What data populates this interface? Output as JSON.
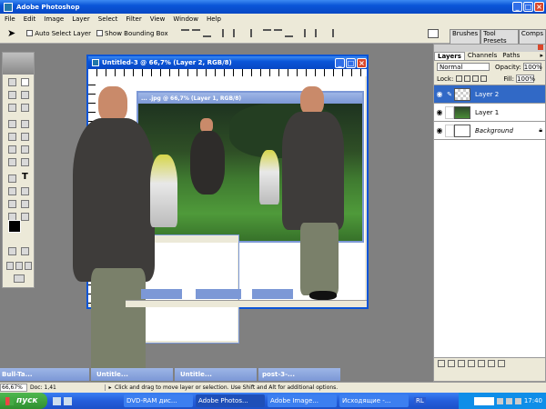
{
  "app": {
    "title": "Adobe Photoshop"
  },
  "menu": [
    "File",
    "Edit",
    "Image",
    "Layer",
    "Select",
    "Filter",
    "View",
    "Window",
    "Help"
  ],
  "options_bar": {
    "auto_select": "Auto Select Layer",
    "show_bbox": "Show Bounding Box",
    "palette_tabs": [
      "Brushes",
      "Tool Presets",
      "Comps"
    ]
  },
  "doc_main": {
    "title": "Untitled-3 @ 66,7% (Layer 2, RGB/8)"
  },
  "doc_photo": {
    "title": "... .jpg @ 66,7% (Layer 1, RGB/8)"
  },
  "minimized": [
    "Bull-Ta...",
    "Untitle...",
    "Untitle...",
    "post-3-..."
  ],
  "status": {
    "zoom": "66,67%",
    "doc": "Doc: 1,41",
    "hint": "Click and drag to move layer or selection.  Use Shift and Alt for additional options."
  },
  "layers_panel": {
    "tabs": [
      "Layers",
      "Channels",
      "Paths"
    ],
    "blend": "Normal",
    "opacity_label": "Opacity:",
    "opacity": "100%",
    "lock_label": "Lock:",
    "fill_label": "Fill:",
    "fill": "100%",
    "layers": [
      "Layer 2",
      "Layer 1",
      "Background"
    ]
  },
  "taskbar": {
    "start": "пуск",
    "tasks": [
      "DVD-RAM дис...",
      "Adobe Photos...",
      "Adobe Image...",
      "Исходящие -..."
    ],
    "lang": "RL",
    "clock": "17:40"
  },
  "colors": {
    "xp_blue": "#0a55d8",
    "ps_gray": "#808080",
    "selected_layer": "#3169c6",
    "start_green": "#3c9a3c"
  }
}
